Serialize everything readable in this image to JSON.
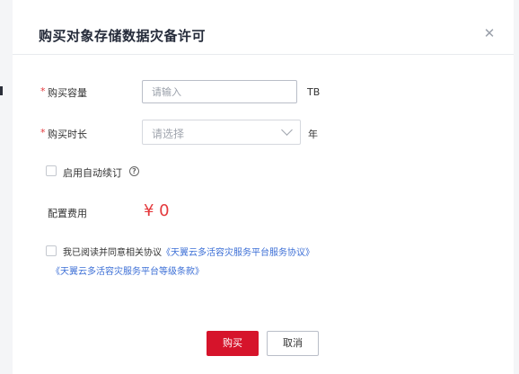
{
  "dialog": {
    "title": "购买对象存储数据灾备许可",
    "close_icon": "close-icon"
  },
  "form": {
    "capacity": {
      "required_mark": "*",
      "label": "购买容量",
      "placeholder": "请输入",
      "unit": "TB"
    },
    "duration": {
      "required_mark": "*",
      "label": "购买时长",
      "placeholder": "请选择",
      "unit": "年",
      "chevron_icon": "chevron-down-icon"
    },
    "auto_renew": {
      "label": "启用自动续订",
      "checked": false,
      "help_icon": "question-circle-icon"
    },
    "fee": {
      "label": "配置费用",
      "value": "¥ 0"
    },
    "agreement": {
      "checked": false,
      "text": "我已阅读并同意相关协议",
      "link1": "《天翼云多活容灾服务平台服务协议》",
      "link2": "《天翼云多活容灾服务平台等级条款》"
    }
  },
  "buttons": {
    "buy": "购买",
    "cancel": "取消"
  },
  "colors": {
    "primary": "#d6142b",
    "price": "#e4393c",
    "link": "#3c6fd6"
  }
}
